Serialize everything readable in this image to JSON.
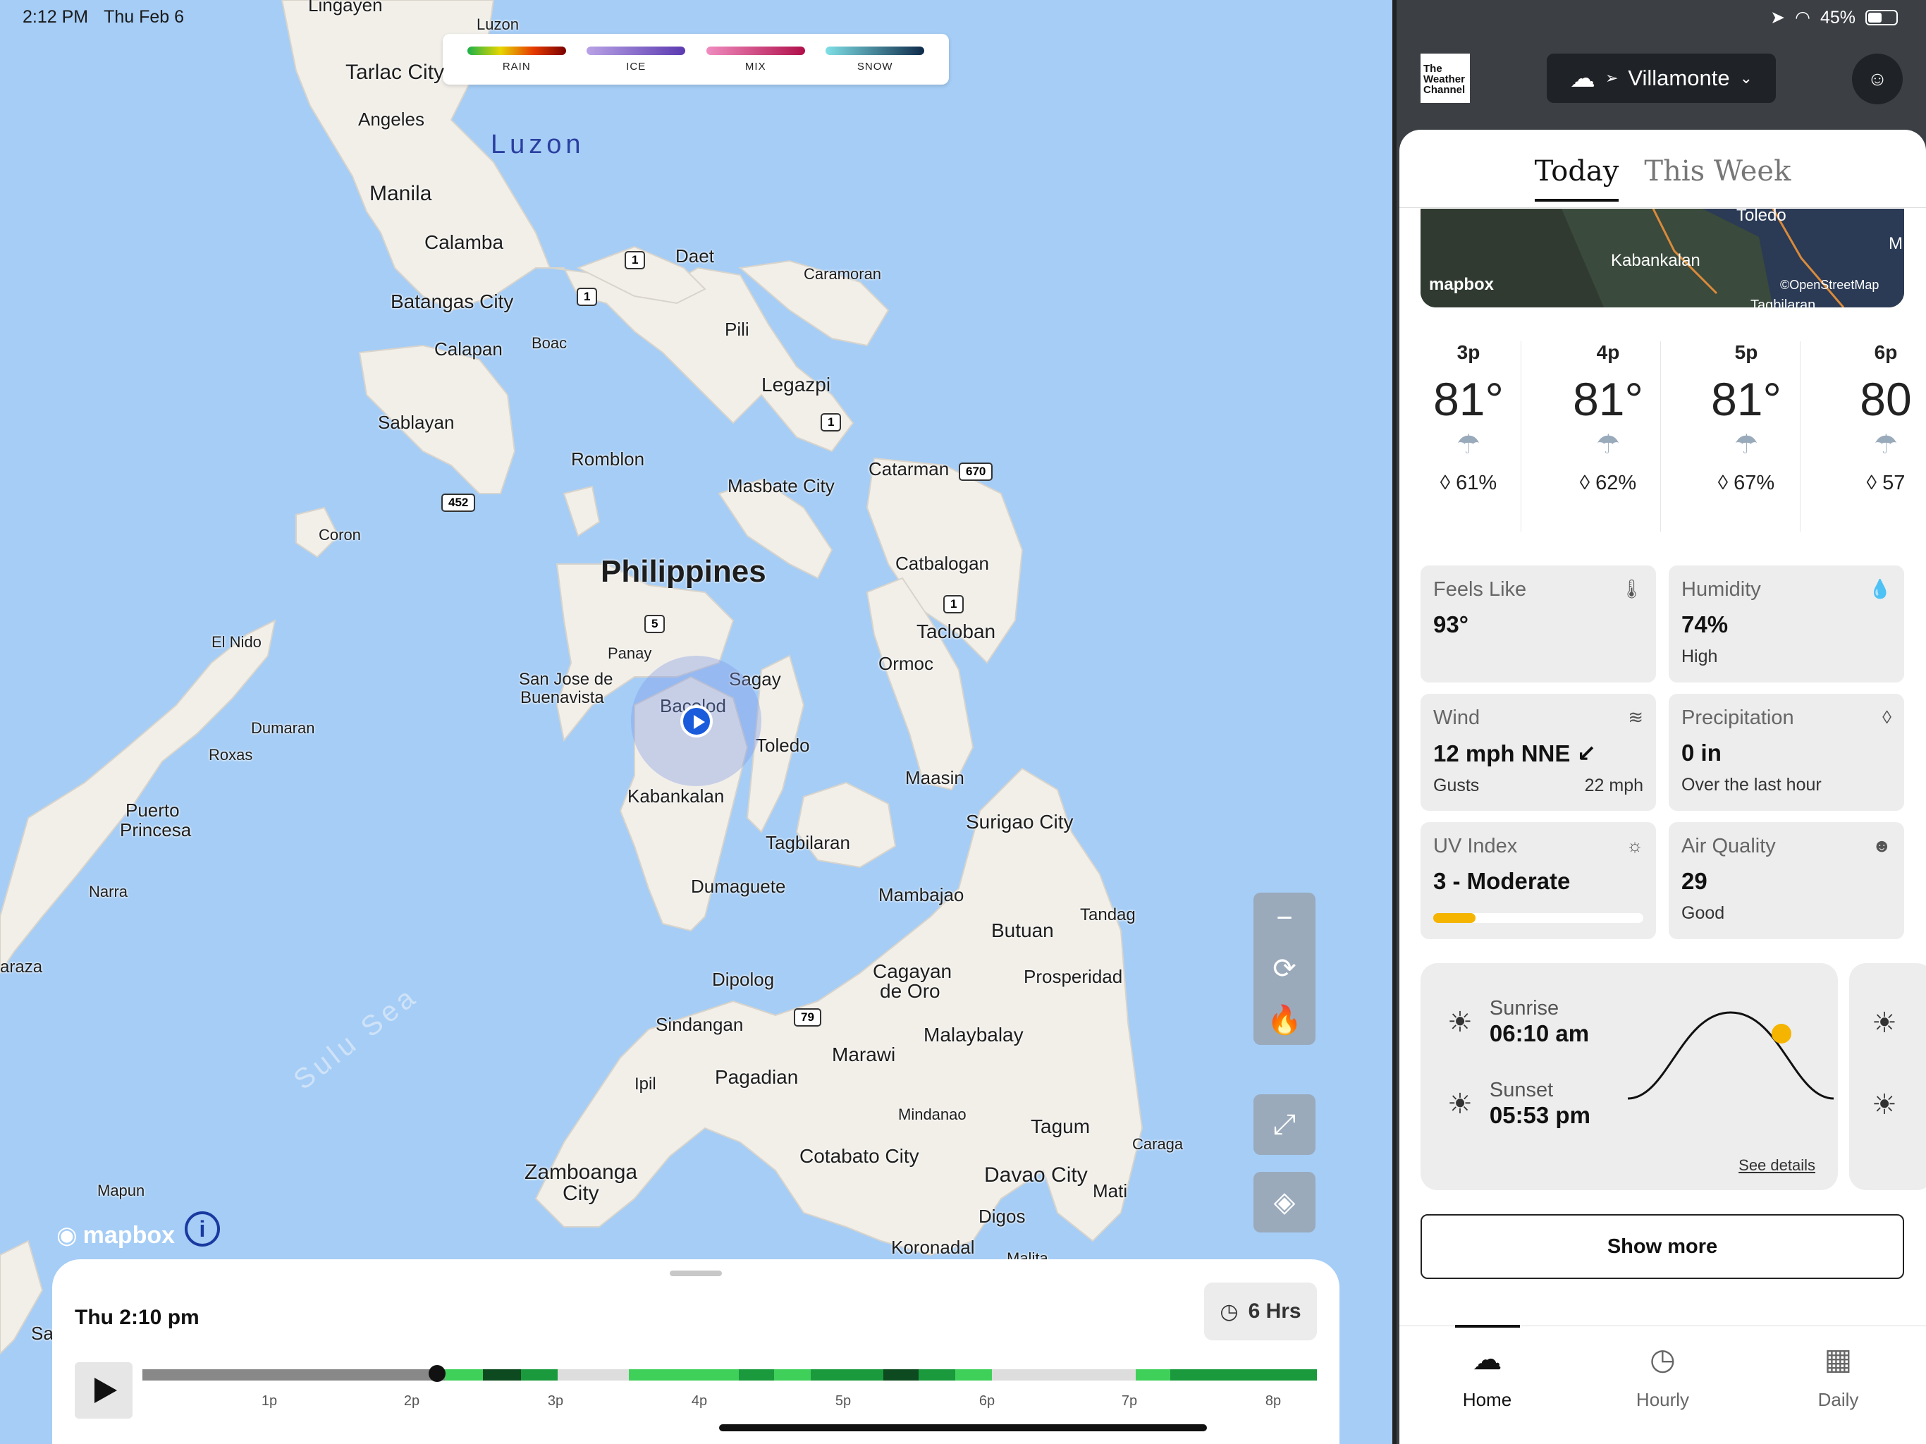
{
  "status_bar": {
    "time": "2:12 PM",
    "date": "Thu Feb 6",
    "battery": "45%"
  },
  "map": {
    "legend": [
      {
        "label": "RAIN",
        "gradient": "linear-gradient(90deg,#1bb04a,#e6d600,#e63b00,#7a0000)"
      },
      {
        "label": "ICE",
        "gradient": "linear-gradient(90deg,#b9a2e6,#5b3ab0)"
      },
      {
        "label": "MIX",
        "gradient": "linear-gradient(90deg,#f08cc0,#b0104a)"
      },
      {
        "label": "SNOW",
        "gradient": "linear-gradient(90deg,#7fe0e6,#0e2a4a)"
      }
    ],
    "places": {
      "lingayen": "Lingayen",
      "luzon_small": "Luzon",
      "tarlac": "Tarlac City",
      "angeles": "Angeles",
      "luzon": "Luzon",
      "manila": "Manila",
      "calamba": "Calamba",
      "batangas": "Batangas City",
      "calapan": "Calapan",
      "boac": "Boac",
      "daet": "Daet",
      "caramoran": "Caramoran",
      "pili": "Pili",
      "legazpi": "Legazpi",
      "sablayan": "Sablayan",
      "romblon": "Romblon",
      "masbate": "Masbate City",
      "catarman": "Catarman",
      "coron": "Coron",
      "philippines": "Philippines",
      "catbalogan": "Catbalogan",
      "el_nido": "El Nido",
      "panay": "Panay",
      "san_jose": "San Jose de",
      "san_jose2": "Buenavista",
      "sagay": "Sagay",
      "bacolod": "Bacolod",
      "tacloban": "Tacloban",
      "ormoc": "Ormoc",
      "dumaran": "Dumaran",
      "roxas": "Roxas",
      "toledo": "Toledo",
      "puerto": "Puerto",
      "puerto2": "Princesa",
      "kabankalan": "Kabankalan",
      "maasin": "Maasin",
      "surigao": "Surigao City",
      "tagbilaran": "Tagbilaran",
      "narra": "Narra",
      "dumaguete": "Dumaguete",
      "mambajao": "Mambajao",
      "tandag": "Tandag",
      "butuan": "Butuan",
      "aborlan": "araza",
      "dipolog": "Dipolog",
      "cagayan": "Cagayan",
      "cagayan2": "de Oro",
      "prosperidad": "Prosperidad",
      "sulu": "Sulu Sea",
      "sindangan": "Sindangan",
      "malaybalay": "Malaybalay",
      "marawi": "Marawi",
      "ipil": "Ipil",
      "pagadian": "Pagadian",
      "mindanao": "Mindanao",
      "tagum": "Tagum",
      "caraga": "Caraga",
      "cotabato": "Cotabato City",
      "zamboanga": "Zamboanga",
      "zamboanga2": "City",
      "davao": "Davao City",
      "mati": "Mati",
      "mapun": "Mapun",
      "digos": "Digos",
      "koronadal": "Koronadal",
      "malita": "Malita",
      "sa": "Sa"
    },
    "shields": {
      "r1a": "1",
      "r1b": "1",
      "r1c": "1",
      "r670": "670",
      "r452": "452",
      "r5": "5",
      "r1d": "1",
      "r79": "79"
    },
    "mapbox": "mapbox",
    "controls": {
      "minus": "−",
      "storm": "⟳",
      "fire": "🔥",
      "expand": "⤢",
      "layers": "◈"
    }
  },
  "timeline": {
    "time": "Thu 2:10 pm",
    "range": "6 Hrs",
    "ticks": [
      "1p",
      "2p",
      "3p",
      "4p",
      "5p",
      "6p",
      "7p",
      "8p"
    ]
  },
  "header": {
    "logo_line1": "The",
    "logo_line2": "Weather",
    "logo_line3": "Channel",
    "location": "Villamonte"
  },
  "tabs": {
    "today": "Today",
    "week": "This Week"
  },
  "minimap": {
    "toledo": "Toledo",
    "kabankalan": "Kabankalan",
    "mapbox": "mapbox",
    "osm": "©OpenStreetMap",
    "tagb": "Tagbilaran",
    "m": "M"
  },
  "hourly": [
    {
      "hour": "3p",
      "temp": "81°",
      "precip": "61%"
    },
    {
      "hour": "4p",
      "temp": "81°",
      "precip": "62%"
    },
    {
      "hour": "5p",
      "temp": "81°",
      "precip": "67%"
    },
    {
      "hour": "6p",
      "temp": "80",
      "precip": "57"
    }
  ],
  "tiles": {
    "feels_like": {
      "title": "Feels Like",
      "value": "93°"
    },
    "humidity": {
      "title": "Humidity",
      "value": "74%",
      "sub": "High"
    },
    "wind": {
      "title": "Wind",
      "value": "12 mph NNE",
      "sub_label": "Gusts",
      "sub_value": "22 mph"
    },
    "precipitation": {
      "title": "Precipitation",
      "value": "0 in",
      "sub": "Over the last hour"
    },
    "uv": {
      "title": "UV Index",
      "value": "3 - Moderate",
      "level": 0.2
    },
    "air": {
      "title": "Air Quality",
      "value": "29",
      "sub": "Good"
    }
  },
  "sun": {
    "sunrise_label": "Sunrise",
    "sunrise": "06:10 am",
    "sunset_label": "Sunset",
    "sunset": "05:53 pm",
    "details": "See details"
  },
  "show_more": "Show more",
  "nav": {
    "home": "Home",
    "hourly": "Hourly",
    "daily": "Daily"
  }
}
